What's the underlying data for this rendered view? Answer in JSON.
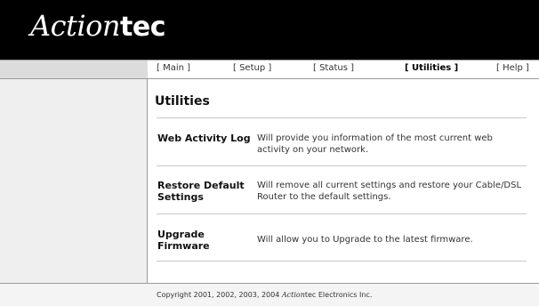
{
  "header": {
    "logo_script": "Action",
    "logo_bold": "tec"
  },
  "nav": {
    "items": [
      {
        "label": "[ Main ]",
        "active": false
      },
      {
        "label": "[ Setup ]",
        "active": false
      },
      {
        "label": "[ Status ]",
        "active": false
      },
      {
        "label": "[ Utilities ]",
        "active": true
      },
      {
        "label": "[ Help ]",
        "active": false
      }
    ]
  },
  "main": {
    "title": "Utilities",
    "rows": [
      {
        "label": "Web Activity Log",
        "description": "Will provide you information of the most current web activity on your network."
      },
      {
        "label": "Restore Default Settings",
        "description": "Will remove all current settings and restore your Cable/DSL Router to the default settings."
      },
      {
        "label": "Upgrade Firmware",
        "description": "Will allow you to Upgrade to the latest firmware."
      }
    ]
  },
  "footer": {
    "prefix": "Copyright 2001, 2002, 2003, 2004 ",
    "brand_script": "Action",
    "brand_rest": "tec Electronics Inc."
  },
  "colors": {
    "header_bg": "#000000",
    "sidebar_bg": "#efefef",
    "nav_left_bg": "#dcdcdc",
    "rule": "#c8c8c8"
  }
}
